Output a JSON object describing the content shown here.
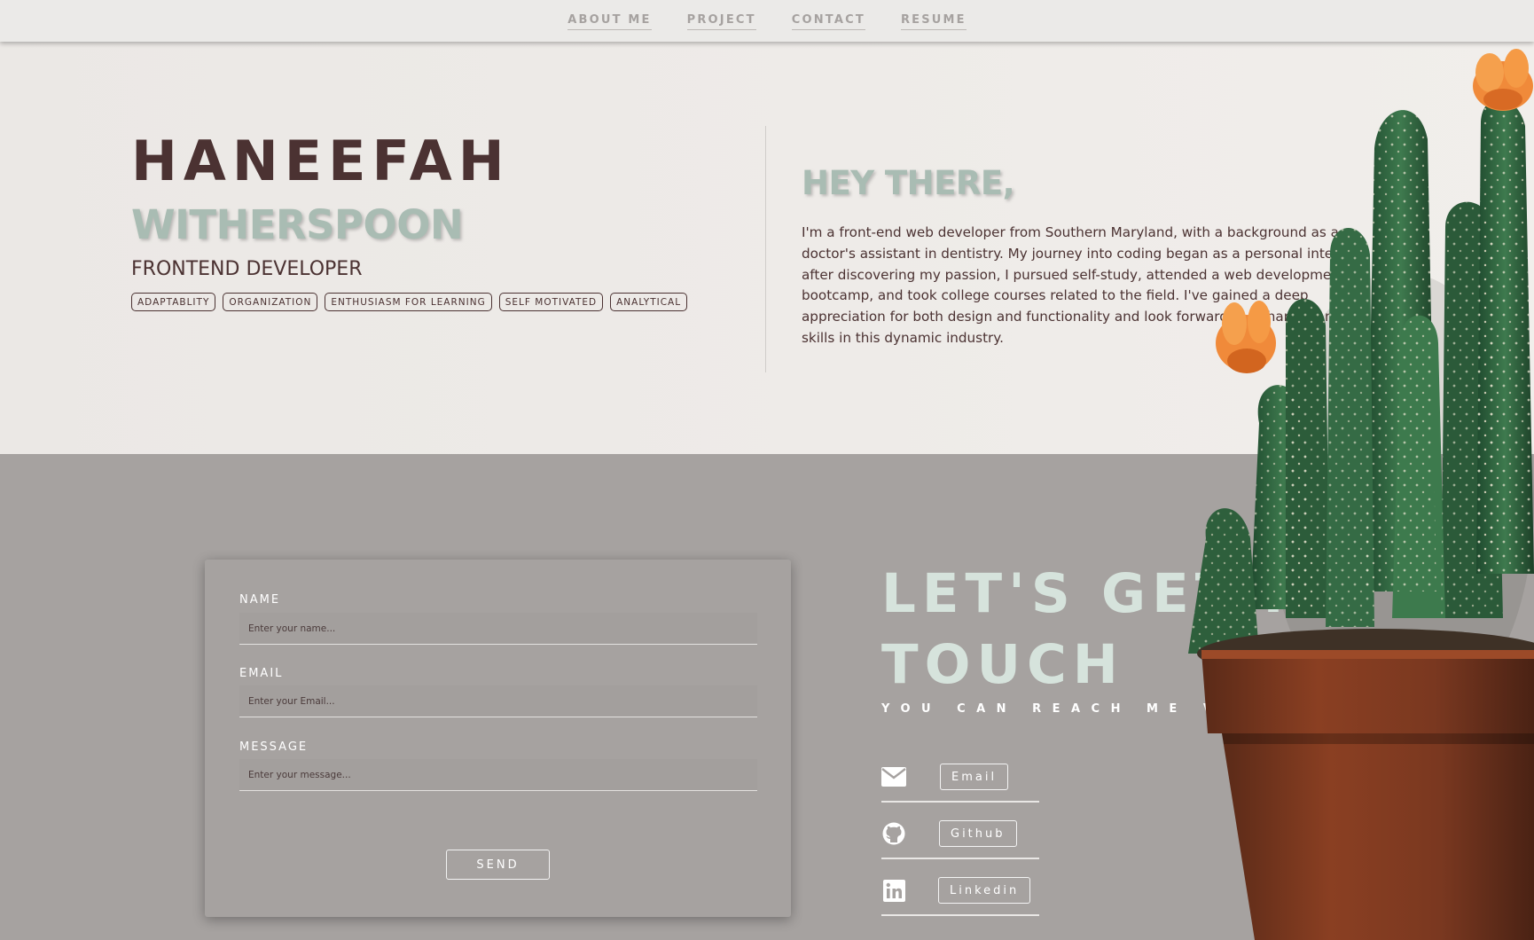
{
  "nav": {
    "items": [
      {
        "label": "ABOUT ME"
      },
      {
        "label": "PROJECT"
      },
      {
        "label": "CONTACT"
      },
      {
        "label": "RESUME"
      }
    ]
  },
  "hero": {
    "first_name": "HANEEFAH",
    "last_name": "WITHERSPOON",
    "role": "FRONTEND DEVELOPER",
    "tags": [
      "ADAPTABLITY",
      "ORGANIZATION",
      "ENTHUSIASM FOR LEARNING",
      "SELF MOTIVATED",
      "ANALYTICAL"
    ],
    "greeting": "HEY THERE,",
    "bio": "I'm a front-end web developer from Southern Maryland, with a background as a doctor's assistant in dentistry. My journey into coding began as a personal interest; after discovering my passion, I pursued self-study, attended a web development bootcamp, and took college courses related to the field. I've gained a deep appreciation for both design and functionality and look forward to enhancing my skills in this dynamic industry."
  },
  "form": {
    "name_label": "NAME",
    "name_placeholder": "Enter your name...",
    "email_label": "EMAIL",
    "email_placeholder": "Enter your Email...",
    "message_label": "MESSAGE",
    "message_placeholder": "Enter your message...",
    "send_label": "SEND"
  },
  "contact": {
    "heading_line1": "LET'S GET IN",
    "heading_line2": "TOUCH",
    "subheading": "YOU CAN REACH ME VIA...",
    "links": [
      {
        "icon": "envelope-icon",
        "label": "Email"
      },
      {
        "icon": "github-icon",
        "label": "Github"
      },
      {
        "icon": "linkedin-icon",
        "label": "Linkedin"
      }
    ]
  },
  "colors": {
    "brand_dark": "#4b3232",
    "accent_sage": "#a9bcb3",
    "contact_bg": "#a6a2a0",
    "cta_mint": "#d6e3dc"
  }
}
